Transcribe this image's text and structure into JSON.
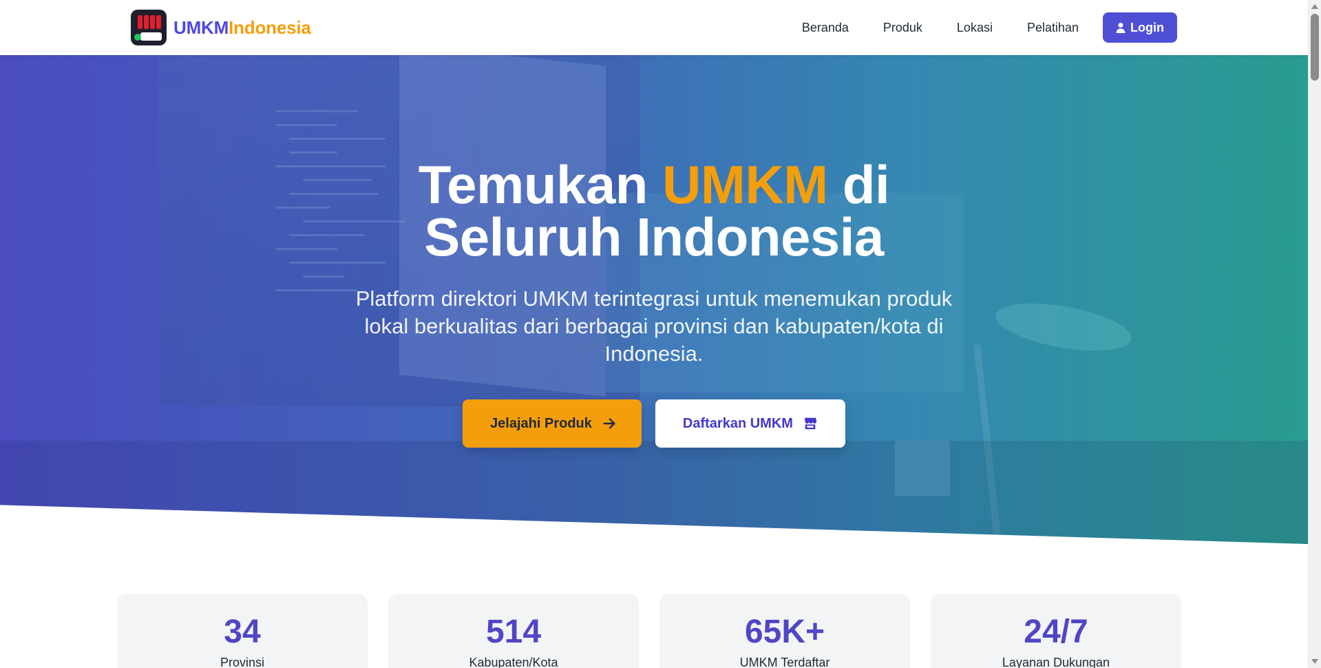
{
  "navbar": {
    "brand_part1": "UMKM",
    "brand_part2": "Indonesia",
    "links": [
      "Beranda",
      "Produk",
      "Lokasi",
      "Pelatihan"
    ],
    "login_label": "Login"
  },
  "hero": {
    "title_part1": "Temukan ",
    "title_accent": "UMKM",
    "title_part2": " di",
    "title_line2": "Seluruh Indonesia",
    "subtitle": "Platform direktori UMKM terintegrasi untuk menemukan produk lokal berkualitas dari berbagai provinsi dan kabupaten/kota di Indonesia.",
    "primary_cta": "Jelajahi Produk",
    "secondary_cta": "Daftarkan UMKM"
  },
  "stats": [
    {
      "value": "34",
      "label": "Provinsi"
    },
    {
      "value": "514",
      "label": "Kabupaten/Kota"
    },
    {
      "value": "65K+",
      "label": "UMKM Terdaftar"
    },
    {
      "value": "24/7",
      "label": "Layanan Dukungan"
    }
  ],
  "colors": {
    "primary": "#4f46e5",
    "accent": "#f59e0b",
    "hero_start": "#4a4cc0",
    "hero_end": "#2a9c90"
  },
  "icons": {
    "brand": "store-logo-icon",
    "login": "user-icon",
    "primary_cta": "arrow-right-icon",
    "secondary_cta": "store-icon"
  }
}
